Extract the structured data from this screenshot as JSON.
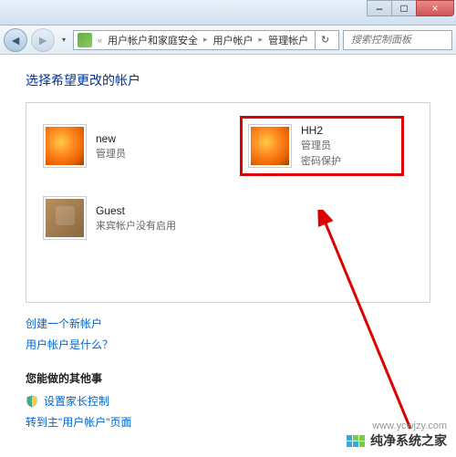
{
  "window": {
    "title": "管理帐户",
    "controls": {
      "minimize": "–",
      "maximize": "□",
      "close": "×"
    }
  },
  "toolbar": {
    "back_glyph": "◄",
    "forward_glyph": "►",
    "breadcrumb": {
      "level1": "用户帐户和家庭安全",
      "level2": "用户帐户",
      "level3": "管理帐户",
      "sep": "▸"
    },
    "refresh_glyph": "↻",
    "search_placeholder": "搜索控制面板"
  },
  "page": {
    "heading": "选择希望更改的帐户"
  },
  "accounts": [
    {
      "name": "new",
      "role": "管理员",
      "extra": "",
      "avatar": "flower",
      "highlighted": false
    },
    {
      "name": "HH2",
      "role": "管理员",
      "extra": "密码保护",
      "avatar": "flower",
      "highlighted": true
    },
    {
      "name": "Guest",
      "role": "来宾帐户没有启用",
      "extra": "",
      "avatar": "bag",
      "highlighted": false
    }
  ],
  "links": {
    "create": "创建一个新帐户",
    "what_is": "用户帐户是什么？"
  },
  "other": {
    "heading": "您能做的其他事",
    "parental": "设置家长控制",
    "goto_main": "转到主\"用户帐户\"页面"
  },
  "watermark": {
    "url": "www.ycwjzy.com",
    "text": "纯净系统之家"
  }
}
